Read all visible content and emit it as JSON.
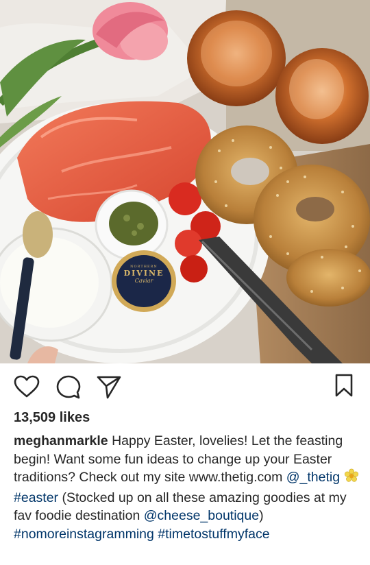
{
  "post": {
    "image_description_name": "post-photo",
    "likes_text": "13,509 likes"
  },
  "caption": {
    "username": "meghanmarkle",
    "part1": "Happy Easter, lovelies! Let the feasting begin! Want some fun ideas to change up your Easter traditions? Check out my site www.thetig.com",
    "mention1": "@_thetig",
    "hashtag1": "#easter",
    "part2": "(Stocked up on all these amazing goodies at my fav foodie destination",
    "mention2": "@cheese_boutique",
    "part3": ")",
    "hashtag2": "#nomoreinstagramming",
    "hashtag3": "#timetostuffmyface"
  },
  "tin_label": {
    "brand_top": "NORTHERN",
    "brand_main": "DIVINE",
    "product": "Caviar"
  },
  "colors": {
    "link": "#003569",
    "text": "#262626"
  },
  "icons": [
    "heart-icon",
    "comment-icon",
    "share-icon",
    "bookmark-icon",
    "flower-emoji-icon"
  ]
}
